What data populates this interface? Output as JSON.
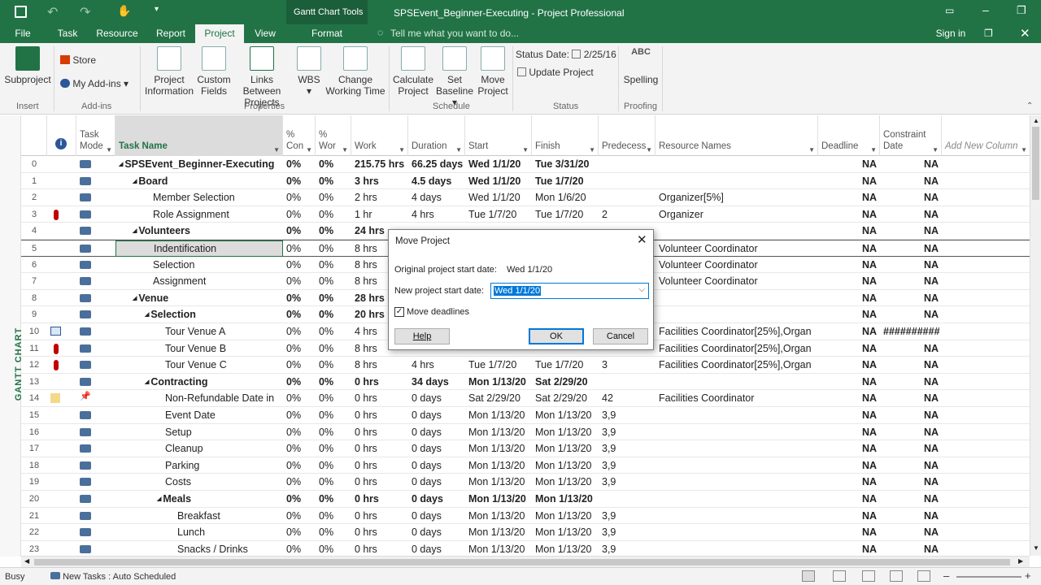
{
  "titlebar": {
    "title": "SPSEvent_Beginner-Executing - Project Professional",
    "context_tools": "Gantt Chart Tools",
    "context_tab": "Format",
    "sign_in": "Sign in",
    "tell_me": "Tell me what you want to do..."
  },
  "tabs": [
    "File",
    "Task",
    "Resource",
    "Report",
    "Project",
    "View"
  ],
  "active_tab": "Project",
  "ribbon": {
    "insert": {
      "subproject": "Subproject",
      "group": "Insert"
    },
    "addins": {
      "store": "Store",
      "my_addins": "My Add-ins",
      "group": "Add-ins"
    },
    "properties": {
      "project_info_1": "Project",
      "project_info_2": "Information",
      "custom_fields_1": "Custom",
      "custom_fields_2": "Fields",
      "links_1": "Links Between",
      "links_2": "Projects",
      "wbs": "WBS",
      "change_1": "Change",
      "change_2": "Working Time",
      "group": "Properties"
    },
    "schedule": {
      "calc_1": "Calculate",
      "calc_2": "Project",
      "set_1": "Set",
      "set_2": "Baseline",
      "move_1": "Move",
      "move_2": "Project",
      "group": "Schedule"
    },
    "status": {
      "status_date_label": "Status Date:",
      "status_date": "2/25/16",
      "update": "Update Project",
      "group": "Status"
    },
    "proofing": {
      "abc": "ABC",
      "spelling": "Spelling",
      "group": "Proofing"
    }
  },
  "sidebar_label": "GANTT CHART",
  "columns": {
    "mode_1": "Task",
    "mode_2": "Mode",
    "name": "Task Name",
    "pct_1": "%",
    "pct_2": "Con",
    "work_pct_1": "%",
    "work_pct_2": "Wor",
    "work": "Work",
    "duration": "Duration",
    "start": "Start",
    "finish": "Finish",
    "pred": "Predecess",
    "resources": "Resource Names",
    "deadline": "Deadline",
    "constraint_1": "Constraint",
    "constraint_2": "Date",
    "add_new": "Add New Column"
  },
  "rows": [
    {
      "id": "0",
      "name": "SPSEvent_Beginner-Executing",
      "pct": "0%",
      "wpct": "0%",
      "work": "215.75 hrs",
      "dur": "66.25 days",
      "start": "Wed 1/1/20",
      "finish": "Tue 3/31/20",
      "pred": "",
      "res": "",
      "deadline": "NA",
      "constraint": "NA",
      "level": 0,
      "summary": true,
      "ind": ""
    },
    {
      "id": "1",
      "name": "Board",
      "pct": "0%",
      "wpct": "0%",
      "work": "3 hrs",
      "dur": "4.5 days",
      "start": "Wed 1/1/20",
      "finish": "Tue 1/7/20",
      "pred": "",
      "res": "",
      "deadline": "NA",
      "constraint": "NA",
      "level": 1,
      "summary": true,
      "ind": ""
    },
    {
      "id": "2",
      "name": "Member Selection",
      "pct": "0%",
      "wpct": "0%",
      "work": "2 hrs",
      "dur": "4 days",
      "start": "Wed 1/1/20",
      "finish": "Mon 1/6/20",
      "pred": "",
      "res": "Organizer[5%]",
      "deadline": "NA",
      "constraint": "NA",
      "level": 2,
      "summary": false,
      "ind": ""
    },
    {
      "id": "3",
      "name": "Role Assignment",
      "pct": "0%",
      "wpct": "0%",
      "work": "1 hr",
      "dur": "4 hrs",
      "start": "Tue 1/7/20",
      "finish": "Tue 1/7/20",
      "pred": "2",
      "res": "Organizer",
      "deadline": "NA",
      "constraint": "NA",
      "level": 2,
      "summary": false,
      "ind": "person"
    },
    {
      "id": "4",
      "name": "Volunteers",
      "pct": "0%",
      "wpct": "0%",
      "work": "24 hrs",
      "dur": "",
      "start": "",
      "finish": "",
      "pred": "",
      "res": "",
      "deadline": "NA",
      "constraint": "NA",
      "level": 1,
      "summary": true,
      "ind": ""
    },
    {
      "id": "5",
      "name": "Indentification",
      "pct": "0%",
      "wpct": "0%",
      "work": "8 hrs",
      "dur": "",
      "start": "",
      "finish": "",
      "pred": "",
      "res": "Volunteer Coordinator",
      "deadline": "NA",
      "constraint": "NA",
      "level": 2,
      "summary": false,
      "ind": "",
      "selected": true
    },
    {
      "id": "6",
      "name": "Selection",
      "pct": "0%",
      "wpct": "0%",
      "work": "8 hrs",
      "dur": "",
      "start": "",
      "finish": "",
      "pred": "",
      "res": "Volunteer Coordinator",
      "deadline": "NA",
      "constraint": "NA",
      "level": 2,
      "summary": false,
      "ind": ""
    },
    {
      "id": "7",
      "name": "Assignment",
      "pct": "0%",
      "wpct": "0%",
      "work": "8 hrs",
      "dur": "",
      "start": "",
      "finish": "",
      "pred": "",
      "res": "Volunteer Coordinator",
      "deadline": "NA",
      "constraint": "NA",
      "level": 2,
      "summary": false,
      "ind": ""
    },
    {
      "id": "8",
      "name": "Venue",
      "pct": "0%",
      "wpct": "0%",
      "work": "28 hrs",
      "dur": "",
      "start": "",
      "finish": "",
      "pred": "",
      "res": "",
      "deadline": "NA",
      "constraint": "NA",
      "level": 1,
      "summary": true,
      "ind": ""
    },
    {
      "id": "9",
      "name": "Selection",
      "pct": "0%",
      "wpct": "0%",
      "work": "20 hrs",
      "dur": "",
      "start": "",
      "finish": "",
      "pred": "",
      "res": "",
      "deadline": "NA",
      "constraint": "NA",
      "level": 2,
      "summary": true,
      "ind": ""
    },
    {
      "id": "10",
      "name": "Tour Venue A",
      "pct": "0%",
      "wpct": "0%",
      "work": "4 hrs",
      "dur": "",
      "start": "",
      "finish": "",
      "pred": "",
      "res": "Facilities Coordinator[25%],Organ",
      "deadline": "NA",
      "constraint": "##########",
      "level": 3,
      "summary": false,
      "ind": "calendar"
    },
    {
      "id": "11",
      "name": "Tour Venue B",
      "pct": "0%",
      "wpct": "0%",
      "work": "8 hrs",
      "dur": "",
      "start": "",
      "finish": "",
      "pred": "",
      "res": "Facilities Coordinator[25%],Organ",
      "deadline": "NA",
      "constraint": "NA",
      "level": 3,
      "summary": false,
      "ind": "person"
    },
    {
      "id": "12",
      "name": "Tour Venue C",
      "pct": "0%",
      "wpct": "0%",
      "work": "8 hrs",
      "dur": "4 hrs",
      "start": "Tue 1/7/20",
      "finish": "Tue 1/7/20",
      "pred": "3",
      "res": "Facilities Coordinator[25%],Organ",
      "deadline": "NA",
      "constraint": "NA",
      "level": 3,
      "summary": false,
      "ind": "person"
    },
    {
      "id": "13",
      "name": "Contracting",
      "pct": "0%",
      "wpct": "0%",
      "work": "0 hrs",
      "dur": "34 days",
      "start": "Mon 1/13/20",
      "finish": "Sat 2/29/20",
      "pred": "",
      "res": "",
      "deadline": "NA",
      "constraint": "NA",
      "level": 2,
      "summary": true,
      "ind": ""
    },
    {
      "id": "14",
      "name": "Non-Refundable Date in",
      "pct": "0%",
      "wpct": "0%",
      "work": "0 hrs",
      "dur": "0 days",
      "start": "Sat 2/29/20",
      "finish": "Sat 2/29/20",
      "pred": "42",
      "res": "Facilities Coordinator",
      "deadline": "NA",
      "constraint": "NA",
      "level": 3,
      "summary": false,
      "ind": "note",
      "manual": true
    },
    {
      "id": "15",
      "name": "Event Date",
      "pct": "0%",
      "wpct": "0%",
      "work": "0 hrs",
      "dur": "0 days",
      "start": "Mon 1/13/20",
      "finish": "Mon 1/13/20",
      "pred": "3,9",
      "res": "",
      "deadline": "NA",
      "constraint": "NA",
      "level": 3,
      "summary": false,
      "ind": ""
    },
    {
      "id": "16",
      "name": "Setup",
      "pct": "0%",
      "wpct": "0%",
      "work": "0 hrs",
      "dur": "0 days",
      "start": "Mon 1/13/20",
      "finish": "Mon 1/13/20",
      "pred": "3,9",
      "res": "",
      "deadline": "NA",
      "constraint": "NA",
      "level": 3,
      "summary": false,
      "ind": ""
    },
    {
      "id": "17",
      "name": "Cleanup",
      "pct": "0%",
      "wpct": "0%",
      "work": "0 hrs",
      "dur": "0 days",
      "start": "Mon 1/13/20",
      "finish": "Mon 1/13/20",
      "pred": "3,9",
      "res": "",
      "deadline": "NA",
      "constraint": "NA",
      "level": 3,
      "summary": false,
      "ind": ""
    },
    {
      "id": "18",
      "name": "Parking",
      "pct": "0%",
      "wpct": "0%",
      "work": "0 hrs",
      "dur": "0 days",
      "start": "Mon 1/13/20",
      "finish": "Mon 1/13/20",
      "pred": "3,9",
      "res": "",
      "deadline": "NA",
      "constraint": "NA",
      "level": 3,
      "summary": false,
      "ind": ""
    },
    {
      "id": "19",
      "name": "Costs",
      "pct": "0%",
      "wpct": "0%",
      "work": "0 hrs",
      "dur": "0 days",
      "start": "Mon 1/13/20",
      "finish": "Mon 1/13/20",
      "pred": "3,9",
      "res": "",
      "deadline": "NA",
      "constraint": "NA",
      "level": 3,
      "summary": false,
      "ind": ""
    },
    {
      "id": "20",
      "name": "Meals",
      "pct": "0%",
      "wpct": "0%",
      "work": "0 hrs",
      "dur": "0 days",
      "start": "Mon 1/13/20",
      "finish": "Mon 1/13/20",
      "pred": "",
      "res": "",
      "deadline": "NA",
      "constraint": "NA",
      "level": 3,
      "summary": true,
      "ind": ""
    },
    {
      "id": "21",
      "name": "Breakfast",
      "pct": "0%",
      "wpct": "0%",
      "work": "0 hrs",
      "dur": "0 days",
      "start": "Mon 1/13/20",
      "finish": "Mon 1/13/20",
      "pred": "3,9",
      "res": "",
      "deadline": "NA",
      "constraint": "NA",
      "level": 4,
      "summary": false,
      "ind": ""
    },
    {
      "id": "22",
      "name": "Lunch",
      "pct": "0%",
      "wpct": "0%",
      "work": "0 hrs",
      "dur": "0 days",
      "start": "Mon 1/13/20",
      "finish": "Mon 1/13/20",
      "pred": "3,9",
      "res": "",
      "deadline": "NA",
      "constraint": "NA",
      "level": 4,
      "summary": false,
      "ind": ""
    },
    {
      "id": "23",
      "name": "Snacks / Drinks",
      "pct": "0%",
      "wpct": "0%",
      "work": "0 hrs",
      "dur": "0 days",
      "start": "Mon 1/13/20",
      "finish": "Mon 1/13/20",
      "pred": "3,9",
      "res": "",
      "deadline": "NA",
      "constraint": "NA",
      "level": 4,
      "summary": false,
      "ind": ""
    }
  ],
  "dialog": {
    "title": "Move Project",
    "orig_label": "Original project start date:",
    "orig_value": "Wed 1/1/20",
    "new_label": "New project start date:",
    "new_value": "Wed 1/1/20",
    "move_deadlines": "Move deadlines",
    "move_deadlines_checked": true,
    "help": "Help",
    "ok": "OK",
    "cancel": "Cancel"
  },
  "status": {
    "state": "Busy",
    "new_tasks": "New Tasks : Auto Scheduled"
  }
}
